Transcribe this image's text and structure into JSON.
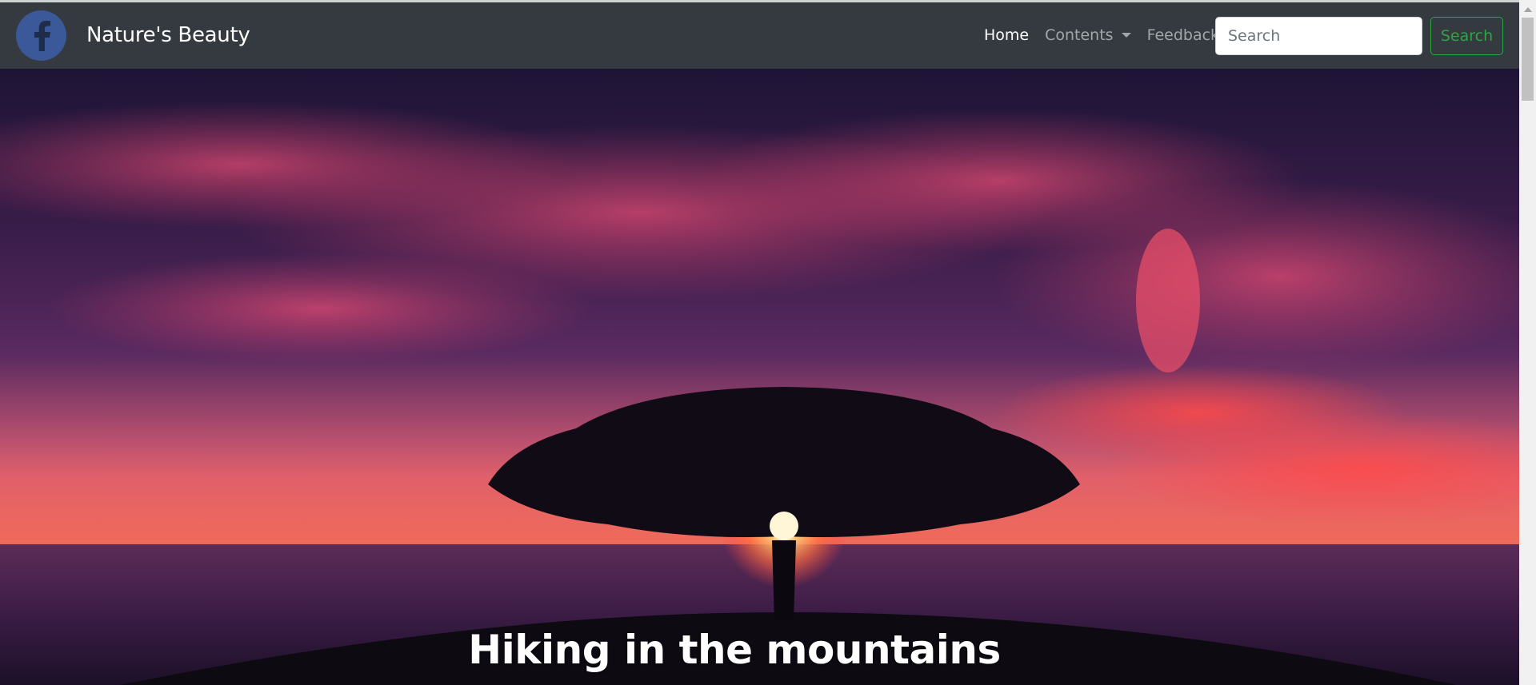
{
  "navbar": {
    "brand_icon": "facebook-icon",
    "brand_name": "Nature's Beauty",
    "links": [
      {
        "label": "Home",
        "active": true
      },
      {
        "label": "Contents",
        "dropdown": true
      },
      {
        "label": "Feedback"
      }
    ],
    "search": {
      "placeholder": "Search",
      "value": ""
    },
    "search_button": "Search"
  },
  "hero": {
    "caption": "Hiking in the mountains"
  },
  "colors": {
    "navbar_bg": "#343a40",
    "facebook_blue": "#3b5998",
    "success_green": "#28a745"
  }
}
